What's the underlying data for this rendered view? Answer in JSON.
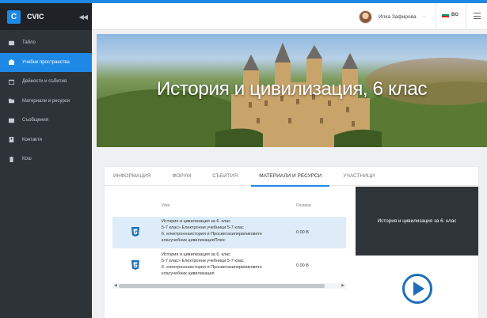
{
  "app": {
    "logo_letter": "C",
    "name": "CVIC"
  },
  "sidebar": {
    "items": [
      {
        "label": "Табло",
        "icon": "dashboard-icon",
        "active": false
      },
      {
        "label": "Учебни пространства",
        "icon": "school-icon",
        "active": true
      },
      {
        "label": "Дейности и събития",
        "icon": "calendar-icon",
        "active": false
      },
      {
        "label": "Материали и ресурси",
        "icon": "folder-icon",
        "active": false
      },
      {
        "label": "Съобщения",
        "icon": "message-icon",
        "active": false
      },
      {
        "label": "Контакти",
        "icon": "contacts-icon",
        "active": false
      },
      {
        "label": "Кош",
        "icon": "trash-icon",
        "active": false
      }
    ]
  },
  "header": {
    "user_name": "Илка Зафирова",
    "language": "BG"
  },
  "banner": {
    "title": "История и цивилизация, 6 клас"
  },
  "tabs": [
    {
      "label": "ИНФОРМАЦИЯ",
      "active": false
    },
    {
      "label": "ФОРУМ",
      "active": false
    },
    {
      "label": "СЪБИТИЯ",
      "active": false
    },
    {
      "label": "МАТЕРИАЛИ И РЕСУРСИ",
      "active": true
    },
    {
      "label": "УЧАСТНИЦИ",
      "active": false
    }
  ],
  "files": {
    "columns": {
      "name": "Име",
      "size": "Размер"
    },
    "rows": [
      {
        "lines": [
          "История и цивилизация за 6. клас",
          "5-7 клас» Електронни учебници 5-7 клас",
          "6.    електроннаистория и    Просветахипервликовете",
          "класучебник     цивилизацияПлюс"
        ],
        "size": "0.00 B",
        "selected": true
      },
      {
        "lines": [
          "История и цивилизация за 6. клас",
          "5-7 клас» Електронни учебници 5-7 клас",
          "6.    електроннаистория и    Просветахипервликовете",
          "класучебник     цивилизация"
        ],
        "size": "0.00 B",
        "selected": false
      }
    ]
  },
  "preview": {
    "title": "История и цивилизация за 6. клас"
  },
  "colors": {
    "accent": "#1e88e5",
    "sidebar_bg": "#2e3338",
    "preview_bg": "#2f3439",
    "play": "#1e6fb8"
  }
}
